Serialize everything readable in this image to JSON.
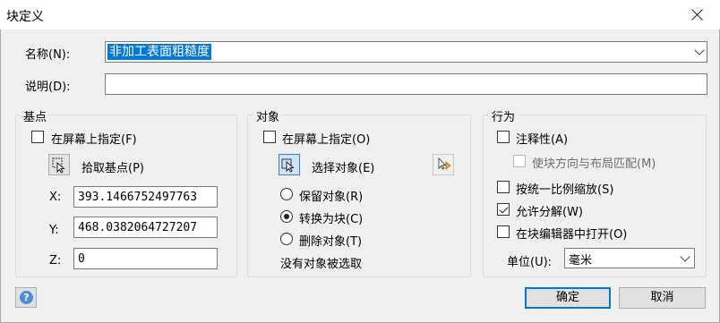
{
  "window": {
    "title": "块定义"
  },
  "name": {
    "label": "名称(N):",
    "value": "非加工表面粗糙度"
  },
  "description": {
    "label": "说明(D):",
    "value": ""
  },
  "base_point": {
    "title": "基点",
    "specify_on_screen": {
      "label": "在屏幕上指定(F)",
      "checked": false
    },
    "pick_button_label": "拾取基点(P)",
    "x_label": "X:",
    "x_value": "393.1466752497763",
    "y_label": "Y:",
    "y_value": "468.0382064727207",
    "z_label": "Z:",
    "z_value": "0"
  },
  "objects": {
    "title": "对象",
    "specify_on_screen": {
      "label": "在屏幕上指定(O)",
      "checked": false
    },
    "select_button_label": "选择对象(E)",
    "retain": {
      "label": "保留对象(R)",
      "selected": false
    },
    "convert": {
      "label": "转换为块(C)",
      "selected": true
    },
    "delete": {
      "label": "删除对象(T)",
      "selected": false
    },
    "status": "没有对象被选取"
  },
  "behavior": {
    "title": "行为",
    "annotative": {
      "label": "注释性(A)",
      "checked": false
    },
    "match_orientation": {
      "label": "使块方向与布局匹配(M)",
      "checked": false,
      "disabled": true
    },
    "scale_uniformly": {
      "label": "按统一比例缩放(S)",
      "checked": false
    },
    "allow_exploding": {
      "label": "允许分解(W)",
      "checked": true
    },
    "open_in_editor": {
      "label": "在块编辑器中打开(O)",
      "checked": false
    },
    "unit_label": "单位(U):",
    "unit_value": "毫米"
  },
  "buttons": {
    "ok": "确定",
    "cancel": "取消",
    "help": "?"
  },
  "colors": {
    "selection": "#0078d7",
    "default_button_border": "#0078d7",
    "help_icon": "#4a90d6"
  }
}
